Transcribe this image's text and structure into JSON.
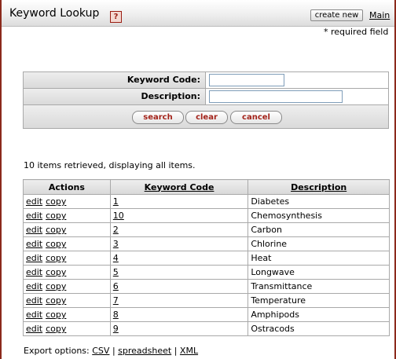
{
  "header": {
    "title": "Keyword Lookup",
    "help_icon": "?",
    "create_new": "create new",
    "main_link": "Main"
  },
  "required_note": "* required field",
  "search": {
    "keyword_code_label": "Keyword Code:",
    "keyword_code_value": "",
    "description_label": "Description:",
    "description_value": "",
    "search_label": "search",
    "clear_label": "clear",
    "cancel_label": "cancel"
  },
  "results_summary": "10 items retrieved, displaying all items.",
  "table": {
    "headers": [
      "Actions",
      "Keyword Code",
      "Description"
    ],
    "action_edit": "edit",
    "action_copy": "copy",
    "rows": [
      {
        "code": "1",
        "description": "Diabetes"
      },
      {
        "code": "10",
        "description": "Chemosynthesis"
      },
      {
        "code": "2",
        "description": "Carbon"
      },
      {
        "code": "3",
        "description": "Chlorine"
      },
      {
        "code": "4",
        "description": "Heat"
      },
      {
        "code": "5",
        "description": "Longwave"
      },
      {
        "code": "6",
        "description": "Transmittance"
      },
      {
        "code": "7",
        "description": "Temperature"
      },
      {
        "code": "8",
        "description": "Amphipods"
      },
      {
        "code": "9",
        "description": "Ostracods"
      }
    ]
  },
  "export": {
    "label": "Export options:",
    "csv": "CSV",
    "spreadsheet": "spreadsheet",
    "xml": "XML",
    "sep": "|"
  }
}
